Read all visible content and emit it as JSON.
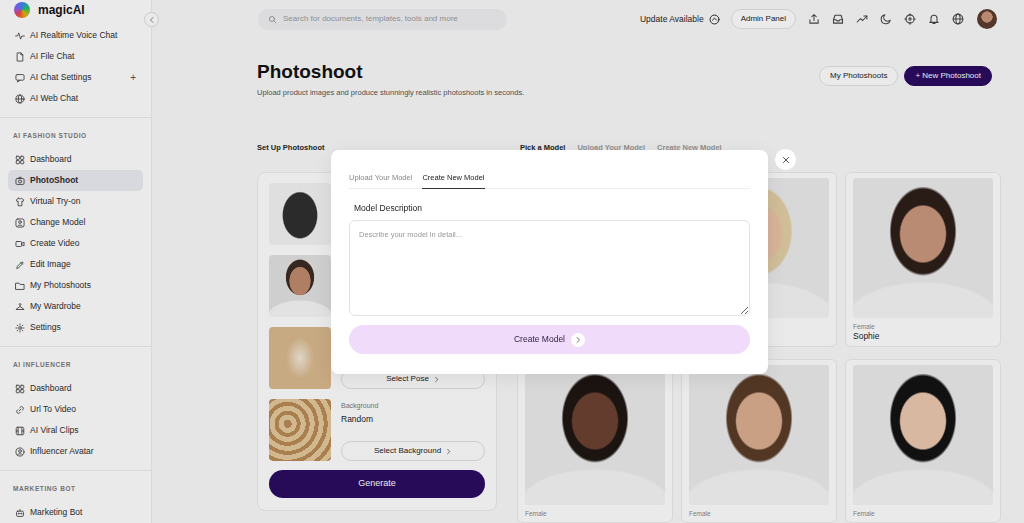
{
  "sidebar": {
    "logo": "magicAI",
    "items": [
      {
        "label": "AI Realtime Voice Chat",
        "selected": false
      },
      {
        "label": "AI File Chat",
        "selected": false
      },
      {
        "label": "AI Chat Settings",
        "selected": false,
        "trail": "+"
      },
      {
        "label": "AI Web Chat",
        "selected": false
      }
    ],
    "sections": [
      {
        "heading": "AI FASHION STUDIO",
        "items": [
          {
            "label": "Dashboard",
            "selected": false
          },
          {
            "label": "PhotoShoot",
            "selected": true
          },
          {
            "label": "Virtual Try-on",
            "selected": false
          },
          {
            "label": "Change Model",
            "selected": false
          },
          {
            "label": "Create Video",
            "selected": false
          },
          {
            "label": "Edit Image",
            "selected": false
          },
          {
            "label": "My Photoshoots",
            "selected": false
          },
          {
            "label": "My Wardrobe",
            "selected": false
          },
          {
            "label": "Settings",
            "selected": false
          }
        ]
      },
      {
        "heading": "AI INFLUENCER",
        "items": [
          {
            "label": "Dashboard",
            "selected": false
          },
          {
            "label": "Url To Video",
            "selected": false
          },
          {
            "label": "AI Viral Clips",
            "selected": false
          },
          {
            "label": "Influencer Avatar",
            "selected": false
          }
        ]
      },
      {
        "heading": "MARKETING BOT",
        "items": [
          {
            "label": "Marketing Bot",
            "selected": false
          }
        ]
      }
    ]
  },
  "topbar": {
    "search": {
      "placeholder": "Search for documents, templates, tools and more"
    },
    "update": "Update Available",
    "admin": "Admin Panel"
  },
  "page": {
    "title": "Photoshoot",
    "subtitle": "Upload product images and produce stunningly realistic photoshoots in seconds.",
    "buttons": [
      {
        "label": "My Photoshoots",
        "kind": "outline"
      },
      {
        "label": "+ New Photoshoot",
        "kind": "primary"
      }
    ]
  },
  "setup": {
    "heading": "Set Up Photoshoot",
    "slots": [
      {
        "kind": "product"
      },
      {
        "kind": "model"
      },
      {
        "kind": "pose",
        "button": "Select Pose"
      },
      {
        "kind": "background",
        "label": "Background",
        "value": "Random",
        "button": "Select Background"
      }
    ],
    "generate": "Generate"
  },
  "models": {
    "tabs": [
      {
        "label": "Pick a Model",
        "selected": true
      },
      {
        "label": "Upload Your Model",
        "selected": false
      },
      {
        "label": "Create New Model",
        "selected": false
      }
    ],
    "cards": [
      {},
      {},
      {
        "gender": "Female",
        "name": "Sophie"
      },
      {
        "gender": "Female"
      },
      {
        "gender": "Female"
      },
      {
        "gender": "Female"
      }
    ]
  },
  "modal": {
    "tabs": [
      {
        "label": "Upload Your Model",
        "selected": false
      },
      {
        "label": "Create New Model",
        "selected": true
      }
    ],
    "label": "Model Description",
    "placeholder": "Describe your model in detail...",
    "button": "Create Model"
  }
}
